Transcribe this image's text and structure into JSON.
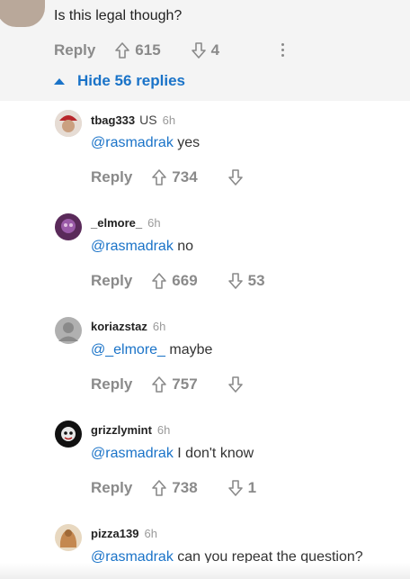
{
  "parent": {
    "text": "Is this legal though?",
    "reply_label": "Reply",
    "upvotes": "615",
    "downvotes": "4",
    "hide_replies_label": "Hide 56 replies"
  },
  "replies": [
    {
      "username": "tbag333",
      "flag": "US",
      "time": "6h",
      "mention": "@rasmadrak",
      "text": "yes",
      "reply_label": "Reply",
      "upvotes": "734",
      "downvotes": "",
      "avatar_color": "#b23a3a"
    },
    {
      "username": "_elmore_",
      "flag": "",
      "time": "6h",
      "mention": "@rasmadrak",
      "text": "no",
      "reply_label": "Reply",
      "upvotes": "669",
      "downvotes": "53",
      "avatar_color": "#7a4a8a"
    },
    {
      "username": "koriazstaz",
      "flag": "",
      "time": "6h",
      "mention": "@_elmore_",
      "text": "maybe",
      "reply_label": "Reply",
      "upvotes": "757",
      "downvotes": "",
      "avatar_color": "#9a9a9a"
    },
    {
      "username": "grizzlymint",
      "flag": "",
      "time": "6h",
      "mention": "@rasmadrak",
      "text": "I don't know",
      "reply_label": "Reply",
      "upvotes": "738",
      "downvotes": "1",
      "avatar_color": "#1a1a1a"
    },
    {
      "username": "pizza139",
      "flag": "",
      "time": "6h",
      "mention": "@rasmadrak",
      "text": "can you repeat the question?",
      "reply_label": "Reply",
      "upvotes": "",
      "downvotes": "",
      "avatar_color": "#c08a50"
    }
  ],
  "icons": {
    "upvote": "arrow-up-outline-icon",
    "downvote": "arrow-down-outline-icon",
    "more": "vertical-dots-icon",
    "collapse": "triangle-up-icon"
  }
}
